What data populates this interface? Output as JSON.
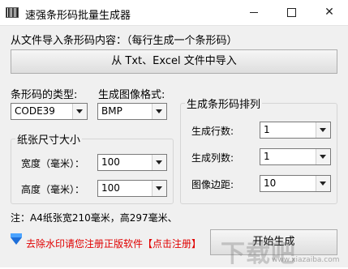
{
  "window": {
    "title": "速强条形码批量生成器",
    "minimize": "",
    "maximize": "",
    "close": "✕"
  },
  "import": {
    "section_label": "从文件导入条形码内容：（每行生成一个条形码）",
    "button_label": "从 Txt、Excel 文件中导入"
  },
  "barcode_type": {
    "label": "条形码的类型:",
    "value": "CODE39"
  },
  "image_format": {
    "label": "生成图像格式:",
    "value": "BMP"
  },
  "paper": {
    "title": "纸张尺寸大小",
    "width_label": "宽度（毫米）：",
    "width_value": "100",
    "height_label": "高度（毫米）：",
    "height_value": "100"
  },
  "layout": {
    "title": "生成条形码排列",
    "rows_label": "生成行数:",
    "rows_value": "1",
    "cols_label": "生成列数:",
    "cols_value": "1",
    "margin_label": "图像边距:",
    "margin_value": "10"
  },
  "note": "注：A4纸张宽210毫米，高297毫米、",
  "promo_text": "去除水印请您注册正版软件【点击注册】",
  "start_button": "开始生成",
  "watermark": {
    "main": "下载吧",
    "sub": "www.xiazaiba.com"
  },
  "icons": {
    "app": "barcode-icon",
    "promo": "diamond-icon"
  },
  "colors": {
    "promo_text": "#e00000",
    "background": "#f0f0f0"
  }
}
